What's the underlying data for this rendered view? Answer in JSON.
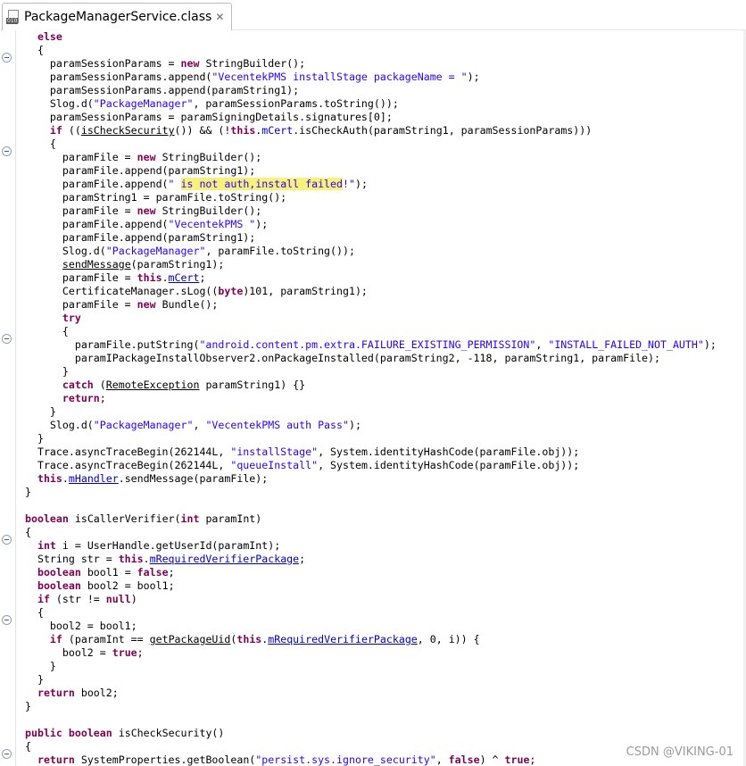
{
  "editor": {
    "tab_title": "PackageManagerService.class",
    "file_icon_badge": "010",
    "close_glyph": "✕",
    "watermark": "CSDN @VIKING-01"
  },
  "code_lines": [
    [
      {
        "t": "  "
      },
      {
        "t": "else",
        "c": "kw"
      }
    ],
    [
      {
        "t": "  {"
      }
    ],
    [
      {
        "t": "    paramSessionParams = "
      },
      {
        "t": "new",
        "c": "kw"
      },
      {
        "t": " StringBuilder();"
      }
    ],
    [
      {
        "t": "    paramSessionParams.append("
      },
      {
        "t": "\"VecentekPMS installStage packageName = \"",
        "c": "str"
      },
      {
        "t": ");"
      }
    ],
    [
      {
        "t": "    paramSessionParams.append(paramString1);"
      }
    ],
    [
      {
        "t": "    Slog.d("
      },
      {
        "t": "\"PackageManager\"",
        "c": "str"
      },
      {
        "t": ", paramSessionParams.toString());"
      }
    ],
    [
      {
        "t": "    paramSessionParams = paramSigningDetails.signatures[0];"
      }
    ],
    [
      {
        "t": "    "
      },
      {
        "t": "if",
        "c": "kw"
      },
      {
        "t": " (("
      },
      {
        "t": "isCheckSecurity",
        "c": "u"
      },
      {
        "t": "()) && (!"
      },
      {
        "t": "this",
        "c": "kw"
      },
      {
        "t": "."
      },
      {
        "t": "mCert",
        "c": "fld"
      },
      {
        "t": ".isCheckAuth(paramString1, paramSessionParams)))"
      }
    ],
    [
      {
        "t": "    {"
      }
    ],
    [
      {
        "t": "      paramFile = "
      },
      {
        "t": "new",
        "c": "kw"
      },
      {
        "t": " StringBuilder();"
      }
    ],
    [
      {
        "t": "      paramFile.append(paramString1);"
      }
    ],
    [
      {
        "t": "      paramFile.append("
      },
      {
        "t": "\" ",
        "c": "str"
      },
      {
        "t": "is not auth,install failed",
        "c": "str hl"
      },
      {
        "t": "!\"",
        "c": "str"
      },
      {
        "t": ");"
      }
    ],
    [
      {
        "t": "      paramString1 = paramFile.toString();"
      }
    ],
    [
      {
        "t": "      paramFile = "
      },
      {
        "t": "new",
        "c": "kw"
      },
      {
        "t": " StringBuilder();"
      }
    ],
    [
      {
        "t": "      paramFile.append("
      },
      {
        "t": "\"VecentekPMS \"",
        "c": "str"
      },
      {
        "t": ");"
      }
    ],
    [
      {
        "t": "      paramFile.append(paramString1);"
      }
    ],
    [
      {
        "t": "      Slog.d("
      },
      {
        "t": "\"PackageManager\"",
        "c": "str"
      },
      {
        "t": ", paramFile.toString());"
      }
    ],
    [
      {
        "t": "      "
      },
      {
        "t": "sendMessage",
        "c": "u"
      },
      {
        "t": "(paramString1);"
      }
    ],
    [
      {
        "t": "      paramFile = "
      },
      {
        "t": "this",
        "c": "kw"
      },
      {
        "t": "."
      },
      {
        "t": "mCert",
        "c": "fld u"
      },
      {
        "t": ";"
      }
    ],
    [
      {
        "t": "      CertificateManager.sLog(("
      },
      {
        "t": "byte",
        "c": "kw"
      },
      {
        "t": ")101, paramString1);"
      }
    ],
    [
      {
        "t": "      paramFile = "
      },
      {
        "t": "new",
        "c": "kw"
      },
      {
        "t": " Bundle();"
      }
    ],
    [
      {
        "t": "      "
      },
      {
        "t": "try",
        "c": "kw"
      }
    ],
    [
      {
        "t": "      {"
      }
    ],
    [
      {
        "t": "        paramFile.putString("
      },
      {
        "t": "\"android.content.pm.extra.FAILURE_EXISTING_PERMISSION\"",
        "c": "str"
      },
      {
        "t": ", "
      },
      {
        "t": "\"INSTALL_FAILED_NOT_AUTH\"",
        "c": "str"
      },
      {
        "t": ");"
      }
    ],
    [
      {
        "t": "        paramIPackageInstallObserver2.onPackageInstalled(paramString2, -118, paramString1, paramFile);"
      }
    ],
    [
      {
        "t": "      }"
      }
    ],
    [
      {
        "t": "      "
      },
      {
        "t": "catch",
        "c": "kw"
      },
      {
        "t": " ("
      },
      {
        "t": "RemoteException",
        "c": "u"
      },
      {
        "t": " paramString1) {}"
      }
    ],
    [
      {
        "t": "      "
      },
      {
        "t": "return",
        "c": "kw"
      },
      {
        "t": ";"
      }
    ],
    [
      {
        "t": "    }"
      }
    ],
    [
      {
        "t": "    Slog.d("
      },
      {
        "t": "\"PackageManager\"",
        "c": "str"
      },
      {
        "t": ", "
      },
      {
        "t": "\"VecentekPMS auth Pass\"",
        "c": "str"
      },
      {
        "t": ");"
      }
    ],
    [
      {
        "t": "  }"
      }
    ],
    [
      {
        "t": "  Trace.asyncTraceBegin(262144L, "
      },
      {
        "t": "\"installStage\"",
        "c": "str"
      },
      {
        "t": ", System.identityHashCode(paramFile.obj));"
      }
    ],
    [
      {
        "t": "  Trace.asyncTraceBegin(262144L, "
      },
      {
        "t": "\"queueInstall\"",
        "c": "str"
      },
      {
        "t": ", System.identityHashCode(paramFile.obj));"
      }
    ],
    [
      {
        "t": "  "
      },
      {
        "t": "this",
        "c": "kw"
      },
      {
        "t": "."
      },
      {
        "t": "mHandler",
        "c": "fld u"
      },
      {
        "t": ".sendMessage(paramFile);"
      }
    ],
    [
      {
        "t": "}"
      }
    ],
    [
      {
        "t": ""
      }
    ],
    [
      {
        "t": "boolean",
        "c": "kw"
      },
      {
        "t": " isCallerVerifier("
      },
      {
        "t": "int",
        "c": "kw"
      },
      {
        "t": " paramInt)"
      }
    ],
    [
      {
        "t": "{"
      }
    ],
    [
      {
        "t": "  "
      },
      {
        "t": "int",
        "c": "kw"
      },
      {
        "t": " i = UserHandle.getUserId(paramInt);"
      }
    ],
    [
      {
        "t": "  String str = "
      },
      {
        "t": "this",
        "c": "kw"
      },
      {
        "t": "."
      },
      {
        "t": "mRequiredVerifierPackage",
        "c": "fld u"
      },
      {
        "t": ";"
      }
    ],
    [
      {
        "t": "  "
      },
      {
        "t": "boolean",
        "c": "kw"
      },
      {
        "t": " bool1 = "
      },
      {
        "t": "false",
        "c": "kw"
      },
      {
        "t": ";"
      }
    ],
    [
      {
        "t": "  "
      },
      {
        "t": "boolean",
        "c": "kw"
      },
      {
        "t": " bool2 = bool1;"
      }
    ],
    [
      {
        "t": "  "
      },
      {
        "t": "if",
        "c": "kw"
      },
      {
        "t": " (str != "
      },
      {
        "t": "null",
        "c": "kw"
      },
      {
        "t": ")"
      }
    ],
    [
      {
        "t": "  {"
      }
    ],
    [
      {
        "t": "    bool2 = bool1;"
      }
    ],
    [
      {
        "t": "    "
      },
      {
        "t": "if",
        "c": "kw"
      },
      {
        "t": " (paramInt == "
      },
      {
        "t": "getPackageUid",
        "c": "u"
      },
      {
        "t": "("
      },
      {
        "t": "this",
        "c": "kw"
      },
      {
        "t": "."
      },
      {
        "t": "mRequiredVerifierPackage",
        "c": "fld u"
      },
      {
        "t": ", 0, i)) {"
      }
    ],
    [
      {
        "t": "      bool2 = "
      },
      {
        "t": "true",
        "c": "kw"
      },
      {
        "t": ";"
      }
    ],
    [
      {
        "t": "    }"
      }
    ],
    [
      {
        "t": "  }"
      }
    ],
    [
      {
        "t": "  "
      },
      {
        "t": "return",
        "c": "kw"
      },
      {
        "t": " bool2;"
      }
    ],
    [
      {
        "t": "}"
      }
    ],
    [
      {
        "t": ""
      }
    ],
    [
      {
        "t": "public",
        "c": "kw"
      },
      {
        "t": " "
      },
      {
        "t": "boolean",
        "c": "kw"
      },
      {
        "t": " isCheckSecurity()"
      }
    ],
    [
      {
        "t": "{"
      }
    ],
    [
      {
        "t": "  "
      },
      {
        "t": "return",
        "c": "kw"
      },
      {
        "t": " SystemProperties.getBoolean("
      },
      {
        "t": "\"persist.sys.ignore_security\"",
        "c": "str"
      },
      {
        "t": ", "
      },
      {
        "t": "false",
        "c": "kw"
      },
      {
        "t": ") ^ "
      },
      {
        "t": "true",
        "c": "kw"
      },
      {
        "t": ";"
      }
    ]
  ]
}
